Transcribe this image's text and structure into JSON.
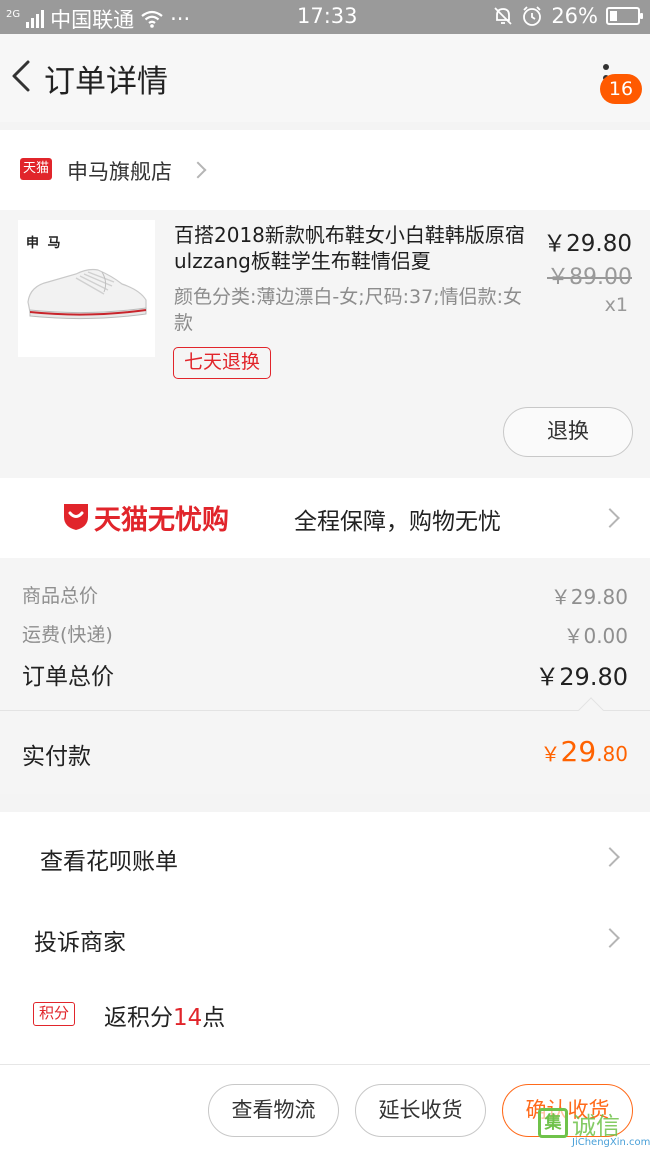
{
  "status_bar": {
    "network": "2G",
    "carrier": "中国联通",
    "dots": "···",
    "time": "17:33",
    "battery": "26%",
    "battery_level": 0.26
  },
  "header": {
    "title": "订单详情",
    "badge_count": "16"
  },
  "store": {
    "logo_text": "天猫",
    "name": "申马旗舰店"
  },
  "product": {
    "brand_text": "申 马",
    "name": "百搭2018新款帆布鞋女小白鞋韩版原宿ulzzang板鞋学生布鞋情侣夏",
    "attributes": "颜色分类:薄边漂白-女;尺码:37;情侣款:女款",
    "service_tag": "七天退换",
    "price": "￥29.80",
    "original_price": "￥89.00",
    "quantity": "x1",
    "refund_button": "退换"
  },
  "worry_free": {
    "title": "天猫无忧购",
    "subtitle": "全程保障，购物无忧"
  },
  "totals": {
    "goods_label": "商品总价",
    "goods_value": "￥29.80",
    "shipping_label": "运费(快递)",
    "shipping_value": "￥0.00",
    "order_label": "订单总价",
    "order_value": "￥29.80",
    "paid_label": "实付款",
    "paid_currency": "￥",
    "paid_int": "29",
    "paid_dec": ".80"
  },
  "links": {
    "huabei": "查看花呗账单",
    "complaint": "投诉商家",
    "points_tag": "积分",
    "points_prefix": "返积分",
    "points_number": "14",
    "points_suffix": "点"
  },
  "bottom_bar": {
    "logistics": "查看物流",
    "extend": "延长收货",
    "confirm": "确认收货"
  },
  "watermark": {
    "box": "集",
    "text": "诚信",
    "url": "JiChengXin.com"
  },
  "colors": {
    "accent_orange": "#ff6200",
    "tmall_red": "#e1252b",
    "badge": "#ff5a00"
  }
}
